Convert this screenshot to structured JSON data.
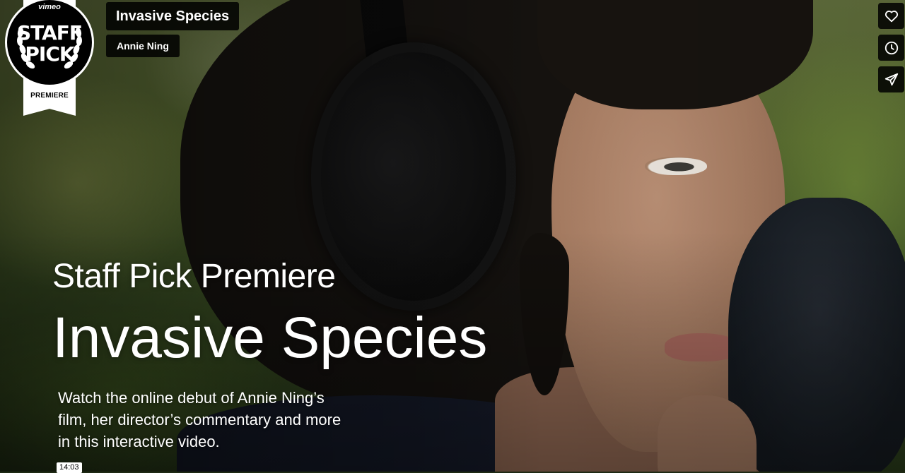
{
  "badge": {
    "brand": "vimeo",
    "line1": "STAFF",
    "line2": "PICK",
    "ribbon": "PREMIERE"
  },
  "video": {
    "title": "Invasive Species",
    "author": "Annie Ning",
    "duration": "14:03"
  },
  "actions": [
    {
      "icon": "heart-icon"
    },
    {
      "icon": "clock-icon"
    },
    {
      "icon": "send-icon"
    }
  ],
  "hero": {
    "eyebrow": "Staff Pick Premiere",
    "title": "Invasive Species",
    "description": "Watch the online debut of Annie Ning’s film, her director’s commentary and more in this interactive video."
  },
  "colors": {
    "pill_bg": "#000000",
    "text": "#ffffff",
    "badge_bg": "#000000"
  }
}
